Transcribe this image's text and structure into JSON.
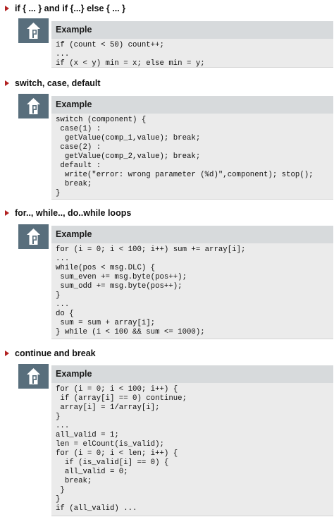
{
  "sections": [
    {
      "heading": "if { ... } and if {...} else { ... }",
      "example_label": "Example",
      "icon": "example-icon",
      "code": "if (count < 50) count++;\n...\nif (x < y) min = x; else min = y;"
    },
    {
      "heading": "switch, case, default",
      "example_label": "Example",
      "icon": "example-icon",
      "code": "switch (component) {\n case(1) :\n  getValue(comp_1,value); break;\n case(2) :\n  getValue(comp_2,value); break;\n default :\n  write(\"error: wrong parameter (%d)\",component); stop();\n  break;\n}"
    },
    {
      "heading": "for.., while.., do..while loops",
      "example_label": "Example",
      "icon": "example-icon",
      "code": "for (i = 0; i < 100; i++) sum += array[i];\n...\nwhile(pos < msg.DLC) {\n sum_even += msg.byte(pos++);\n sum_odd += msg.byte(pos++);\n}\n...\ndo {\n sum = sum + array[i];\n} while (i < 100 && sum <= 1000);"
    },
    {
      "heading": "continue and break",
      "example_label": "Example",
      "icon": "example-icon",
      "code": "for (i = 0; i < 100; i++) {\n if (array[i] == 0) continue;\n array[i] = 1/array[i];\n}\n...\nall_valid = 1;\nlen = elCount(is_valid);\nfor (i = 0; i < len; i++) {\n  if (is_valid[i] == 0) {\n  all_valid = 0;\n  break;\n }\n}\nif (all_valid) ..."
    }
  ],
  "colors": {
    "bullet": "#b22222",
    "icon_background": "#586e7c",
    "example_header": "#d7dadc",
    "example_body": "#ebebeb"
  }
}
